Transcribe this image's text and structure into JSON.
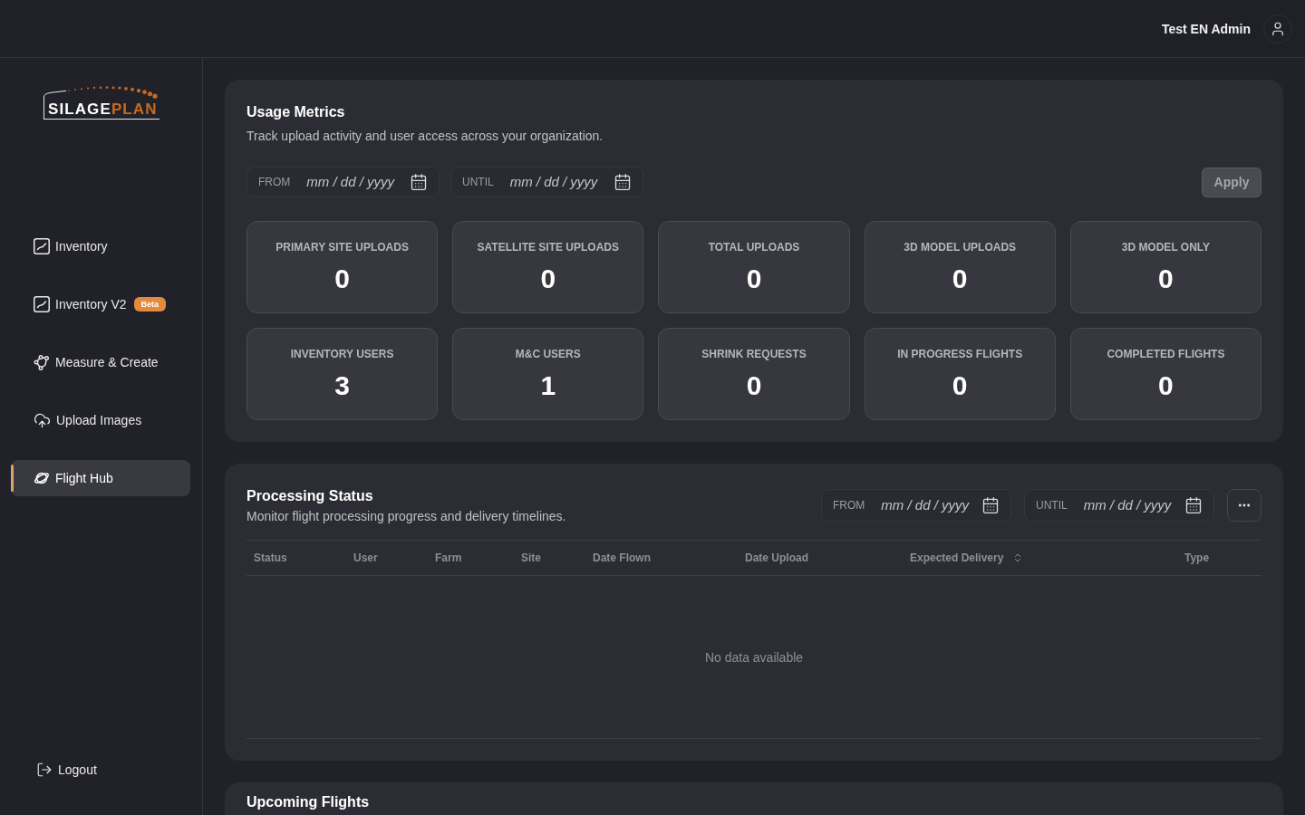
{
  "header": {
    "user_name": "Test EN Admin"
  },
  "sidebar": {
    "logo": {
      "primary": "SILAGE",
      "accent": "PLAN"
    },
    "items": [
      {
        "label": "Inventory",
        "kind": "chart",
        "selected": false
      },
      {
        "label": "Inventory V2",
        "kind": "chart",
        "badge": "Beta",
        "selected": false
      },
      {
        "label": "Measure & Create",
        "kind": "nodes",
        "selected": false
      },
      {
        "label": "Upload Images",
        "kind": "upload",
        "selected": false
      },
      {
        "label": "Flight Hub",
        "kind": "planet",
        "selected": true
      }
    ],
    "logout": {
      "label": "Logout"
    }
  },
  "usage_metrics": {
    "title": "Usage Metrics",
    "subtitle": "Track upload activity and user access across your organization.",
    "filters": [
      {
        "label": "FROM",
        "placeholder": "mm / dd / yyyy"
      },
      {
        "label": "UNTIL",
        "placeholder": "mm / dd / yyyy"
      }
    ],
    "apply_button": {
      "label": "Apply",
      "disabled": true
    },
    "metrics": [
      {
        "label": "PRIMARY SITE UPLOADS",
        "value": "0"
      },
      {
        "label": "SATELLITE SITE UPLOADS",
        "value": "0"
      },
      {
        "label": "TOTAL UPLOADS",
        "value": "0"
      },
      {
        "label": "3D MODEL UPLOADS",
        "value": "0"
      },
      {
        "label": "3D MODEL ONLY",
        "value": "0"
      },
      {
        "label": "INVENTORY USERS",
        "value": "3"
      },
      {
        "label": "M&C USERS",
        "value": "1"
      },
      {
        "label": "SHRINK REQUESTS",
        "value": "0"
      },
      {
        "label": "IN PROGRESS FLIGHTS",
        "value": "0"
      },
      {
        "label": "COMPLETED FLIGHTS",
        "value": "0"
      }
    ]
  },
  "processing_status": {
    "title": "Processing Status",
    "subtitle": "Monitor flight processing progress and delivery timelines.",
    "filters": [
      {
        "label": "FROM",
        "placeholder": "mm / dd / yyyy"
      },
      {
        "label": "UNTIL",
        "placeholder": "mm / dd / yyyy"
      }
    ],
    "table": {
      "columns": [
        {
          "label": "Status",
          "sortable": false
        },
        {
          "label": "User",
          "sortable": false
        },
        {
          "label": "Farm",
          "sortable": false
        },
        {
          "label": "Site",
          "sortable": false
        },
        {
          "label": "Date Flown",
          "sortable": false
        },
        {
          "label": "Date Upload",
          "sortable": false
        },
        {
          "label": "Expected Delivery",
          "sortable": true
        },
        {
          "label": "Type",
          "sortable": false
        }
      ],
      "empty_text": "No data available"
    }
  },
  "upcoming_flights": {
    "title": "Upcoming Flights"
  }
}
